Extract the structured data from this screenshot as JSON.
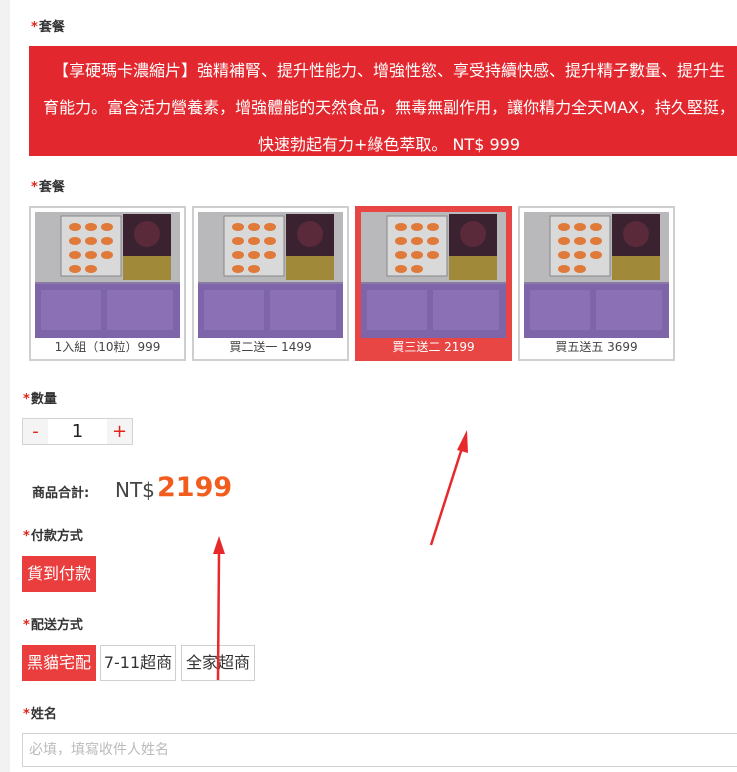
{
  "section_package_1": {
    "label": "套餐"
  },
  "promo": {
    "line1": "【享硬瑪卡濃縮片】強精補腎、提升性能力、增強性慾、享受持續快感、提升精子數量、提升生",
    "line2": "育能力。富含活力營養素，增強體能的天然食品，無毒無副作用，讓你精力全天MAX，持久堅挺，",
    "line3": "快速勃起有力+綠色萃取。 NT$ 999"
  },
  "section_package_2": {
    "label": "套餐"
  },
  "packages": [
    {
      "caption": "1入組（10粒）999",
      "selected": false
    },
    {
      "caption": "買二送一 1499",
      "selected": false
    },
    {
      "caption": "買三送二 2199",
      "selected": true
    },
    {
      "caption": "買五送五 3699",
      "selected": false
    }
  ],
  "quantity": {
    "label": "數量",
    "minus": "-",
    "value": "1",
    "plus": "+"
  },
  "total": {
    "label": "商品合計:",
    "prefix": "NT$",
    "value": "2199"
  },
  "payment": {
    "label": "付款方式",
    "options": [
      "貨到付款"
    ]
  },
  "shipping": {
    "label": "配送方式",
    "options": [
      "黑貓宅配",
      "7-11超商",
      "全家超商"
    ]
  },
  "name": {
    "label": "姓名",
    "placeholder": "必填，填寫收件人姓名"
  },
  "colors": {
    "accent": "#e2282e",
    "price": "#f25c1d",
    "annotation_arrow": "#e8292b"
  }
}
